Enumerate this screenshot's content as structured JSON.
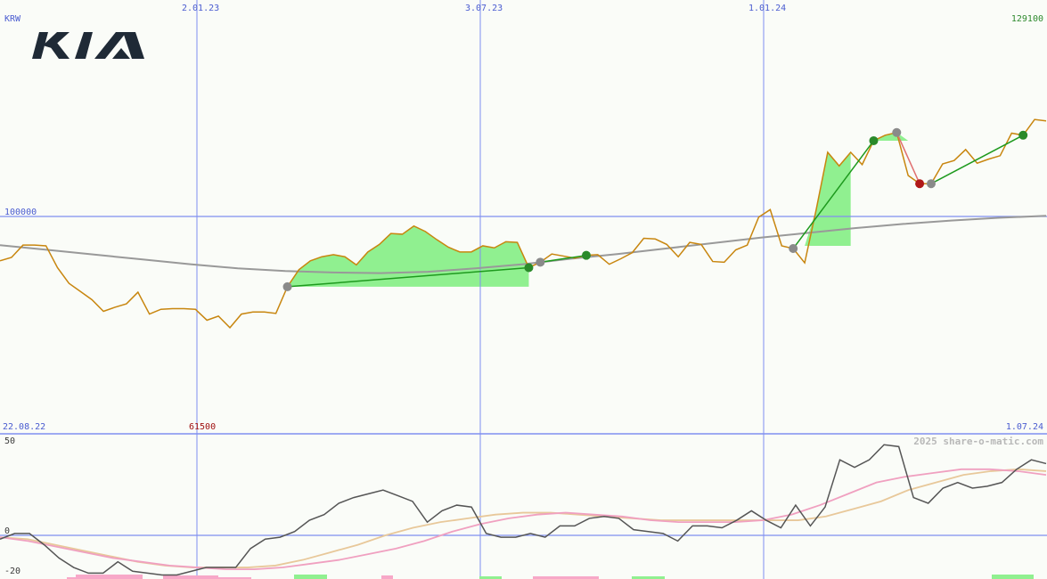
{
  "labels": {
    "currency": "KRW",
    "x_top": [
      "2.01.23",
      "3.07.23",
      "1.01.24"
    ],
    "y_max": "129100",
    "y_ref": "100000",
    "y_min": "61500",
    "date_start": "22.08.22",
    "date_end": "1.07.24",
    "osc_max": "50",
    "osc_zero": "0",
    "osc_min": "-20",
    "watermark": "2025 share-o-matic.com"
  },
  "logo": {
    "text": "KIA",
    "color": "#1f2a36"
  },
  "colors": {
    "price": "#c8860f",
    "ma": "#999999",
    "gain_fill": "#90f090",
    "trend": "#1e9a1e",
    "grid": "#7f8ef0",
    "osc": "#555555",
    "osc_fast": "#f0a0c0",
    "osc_slow": "#e8c89a",
    "bar_pos": "#90f090",
    "bar_neg": "#f7a8c8"
  },
  "chart_data": [
    {
      "type": "line",
      "name": "price",
      "y_axis": {
        "min": 61500,
        "max": 129100,
        "reference": 100000
      },
      "x_range": [
        "22.08.22",
        "1.07.24"
      ],
      "series": [
        {
          "name": "price",
          "values": [
            93500,
            94000,
            95800,
            95800,
            95700,
            92500,
            90200,
            89000,
            87800,
            86100,
            86700,
            87200,
            88900,
            85700,
            86400,
            86500,
            86500,
            86400,
            84800,
            85400,
            83700,
            85700,
            86000,
            86000,
            85800,
            89700,
            92200,
            93500,
            94100,
            94400,
            94100,
            92900,
            94800,
            95900,
            97500,
            97400,
            98600,
            97800,
            96600,
            95500,
            94800,
            94800,
            95700,
            95400,
            96300,
            96200,
            92500,
            93300,
            94500,
            94200,
            93900,
            94300,
            94400,
            93000,
            93800,
            94700,
            96800,
            96700,
            95900,
            94100,
            96200,
            95900,
            93400,
            93300,
            95100,
            95800,
            99900,
            101000,
            95700,
            95300,
            93200,
            101000,
            109400,
            107400,
            109400,
            107600,
            111100,
            111900,
            112300,
            106000,
            104800,
            104800,
            107700,
            108200,
            109800,
            107800,
            108400,
            108900,
            112200,
            111900,
            114200,
            114000
          ],
          "x_dates_approx": "weekly from 22.08.22 to 1.07.24"
        },
        {
          "name": "moving_average",
          "values": [
            95800,
            95100,
            94400,
            93700,
            93000,
            92400,
            92000,
            91800,
            91700,
            91900,
            92400,
            93000,
            93800,
            94500,
            95300,
            96100,
            96900,
            97600,
            98300,
            98900,
            99400,
            99800,
            100100
          ]
        }
      ],
      "signals": [
        {
          "date": "~20.02.23",
          "kind": "entry",
          "color": "grey"
        },
        {
          "date": "~27.06.23",
          "kind": "exit",
          "color": "green"
        },
        {
          "date": "~3.07.23",
          "kind": "entry",
          "color": "grey"
        },
        {
          "date": "~12.07.23",
          "kind": "exit",
          "color": "green"
        },
        {
          "date": "~25.11.23",
          "kind": "entry",
          "color": "grey"
        },
        {
          "date": "~05.01.24",
          "kind": "exit",
          "color": "green"
        },
        {
          "date": "~15.01.24",
          "kind": "entry",
          "color": "grey"
        },
        {
          "date": "~25.01.24",
          "kind": "exit",
          "color": "red"
        },
        {
          "date": "~31.01.24",
          "kind": "entry",
          "color": "grey"
        },
        {
          "date": "~26.03.24",
          "kind": "exit",
          "color": "green"
        }
      ]
    },
    {
      "type": "line",
      "name": "oscillator",
      "y_axis": {
        "min": -20,
        "max": 50,
        "zero": 0
      },
      "series": [
        {
          "name": "oscillator",
          "values": [
            -2,
            1,
            1,
            -5,
            -12,
            -17,
            -20,
            -20,
            -14,
            -19,
            -20,
            -21,
            -21,
            -19,
            -17,
            -17,
            -17,
            -7,
            -2,
            -1,
            2,
            8,
            11,
            17,
            20,
            22,
            24,
            21,
            18,
            7,
            13,
            16,
            15,
            1,
            -1,
            -1,
            1,
            -1,
            5,
            5,
            9,
            10,
            9,
            3,
            2,
            1,
            -3,
            5,
            5,
            4,
            8,
            13,
            8,
            4,
            16,
            5,
            15,
            40,
            36,
            40,
            48,
            47,
            20,
            17,
            25,
            28,
            25,
            26,
            28,
            35,
            40,
            38
          ]
        },
        {
          "name": "fast_avg",
          "values": [
            -1,
            -3,
            -6,
            -9,
            -12,
            -14,
            -16,
            -17,
            -18,
            -18,
            -17,
            -15,
            -13,
            -10,
            -7,
            -3,
            2,
            6,
            9,
            11,
            12,
            11,
            10,
            8,
            7,
            7,
            7,
            8,
            11,
            16,
            22,
            28,
            31,
            33,
            35,
            35,
            34,
            32
          ]
        },
        {
          "name": "slow_avg",
          "values": [
            -1,
            -2,
            -5,
            -8,
            -11,
            -14,
            -16,
            -17,
            -17,
            -17,
            -16,
            -13,
            -9,
            -5,
            0,
            4,
            7,
            9,
            11,
            12,
            12,
            11,
            10,
            9,
            8,
            8,
            8,
            8,
            8,
            8,
            10,
            14,
            18,
            24,
            28,
            32,
            34,
            35,
            34
          ]
        }
      ],
      "bars": [
        {
          "from_x": 75,
          "to_x": 85,
          "sign": "neg",
          "h": 2
        },
        {
          "from_x": 85,
          "to_x": 160,
          "sign": "neg",
          "h": 5
        },
        {
          "from_x": 183,
          "to_x": 245,
          "sign": "neg",
          "h": 4
        },
        {
          "from_x": 245,
          "to_x": 282,
          "sign": "neg",
          "h": 2
        },
        {
          "from_x": 330,
          "to_x": 367,
          "sign": "pos",
          "h": 5
        },
        {
          "from_x": 428,
          "to_x": 441,
          "sign": "neg",
          "h": 4
        },
        {
          "from_x": 538,
          "to_x": 563,
          "sign": "pos",
          "h": 3
        },
        {
          "from_x": 598,
          "to_x": 672,
          "sign": "neg",
          "h": 3
        },
        {
          "from_x": 709,
          "to_x": 746,
          "sign": "pos",
          "h": 3
        },
        {
          "from_x": 1113,
          "to_x": 1160,
          "sign": "pos",
          "h": 5
        }
      ]
    }
  ]
}
